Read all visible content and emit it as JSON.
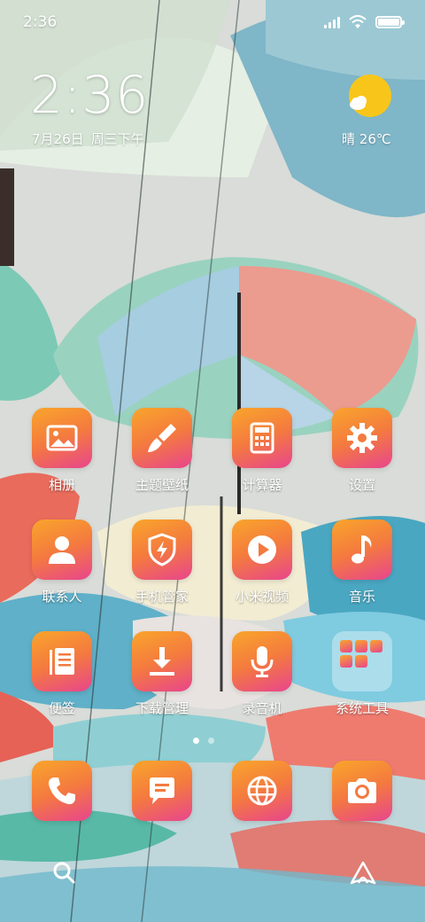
{
  "status_bar": {
    "time": "2:36"
  },
  "clock": {
    "time": "2:36",
    "date": "7月26日",
    "weekday": "周三下午"
  },
  "weather": {
    "condition": "晴",
    "temperature": "26℃",
    "icon": "sun-cloud-icon"
  },
  "apps": [
    {
      "label": "相册",
      "icon": "gallery-icon"
    },
    {
      "label": "主题壁纸",
      "icon": "brush-icon"
    },
    {
      "label": "计算器",
      "icon": "calculator-icon"
    },
    {
      "label": "设置",
      "icon": "gear-icon"
    },
    {
      "label": "联系人",
      "icon": "person-icon"
    },
    {
      "label": "手机管家",
      "icon": "shield-bolt-icon"
    },
    {
      "label": "小米视频",
      "icon": "play-icon"
    },
    {
      "label": "音乐",
      "icon": "music-note-icon"
    },
    {
      "label": "便签",
      "icon": "notes-icon"
    },
    {
      "label": "下载管理",
      "icon": "download-icon"
    },
    {
      "label": "录音机",
      "icon": "microphone-icon"
    },
    {
      "label": "系统工具",
      "icon": "folder-icon"
    }
  ],
  "dock": [
    {
      "icon": "phone-icon"
    },
    {
      "icon": "message-icon"
    },
    {
      "icon": "browser-globe-icon"
    },
    {
      "icon": "camera-icon"
    }
  ],
  "page_indicator": {
    "pages": 2,
    "current": 1
  },
  "bottom_bar": {
    "left": "search-icon",
    "right": "assistant-icon"
  },
  "colors": {
    "icon_gradient_start": "#f9a52b",
    "icon_gradient_end": "#e8458e",
    "weather_sun": "#f8c61a"
  }
}
